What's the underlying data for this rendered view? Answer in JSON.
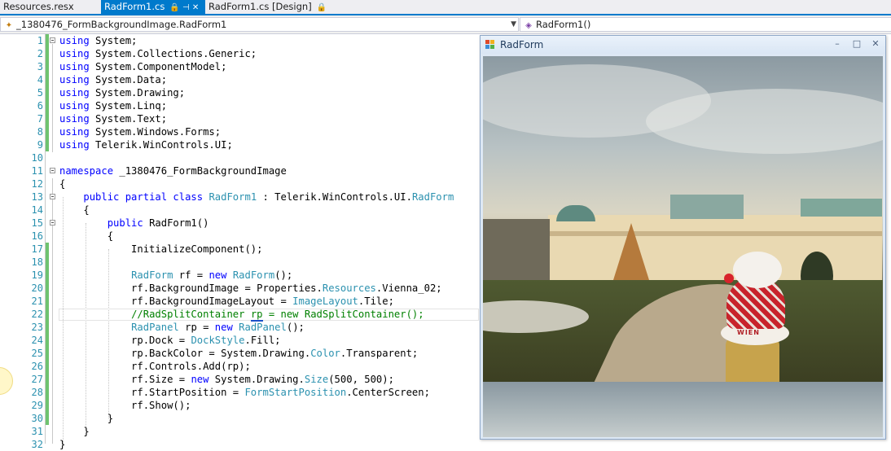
{
  "tabs": [
    {
      "label": "Resources.resx",
      "active": false,
      "icons": ""
    },
    {
      "label": "RadForm1.cs",
      "active": true,
      "icons": "🔒 ⊣ ✕"
    },
    {
      "label": "RadForm1.cs [Design]",
      "active": false,
      "icons": "🔒"
    }
  ],
  "nav": {
    "class_combo": "_1380476_FormBackgroundImage.RadForm1",
    "member_combo": "RadForm1()"
  },
  "code_lines": [
    {
      "n": "1",
      "html": "<span class=\"kw\">using</span> System;"
    },
    {
      "n": "2",
      "html": "<span class=\"kw\">using</span> System.Collections.Generic;"
    },
    {
      "n": "3",
      "html": "<span class=\"kw\">using</span> System.ComponentModel;"
    },
    {
      "n": "4",
      "html": "<span class=\"kw\">using</span> System.Data;"
    },
    {
      "n": "5",
      "html": "<span class=\"kw\">using</span> System.Drawing;"
    },
    {
      "n": "6",
      "html": "<span class=\"kw\">using</span> System.Linq;"
    },
    {
      "n": "7",
      "html": "<span class=\"kw\">using</span> System.Text;"
    },
    {
      "n": "8",
      "html": "<span class=\"kw\">using</span> System.Windows.Forms;"
    },
    {
      "n": "9",
      "html": "<span class=\"kw\">using</span> Telerik.WinControls.UI;"
    },
    {
      "n": "10",
      "html": ""
    },
    {
      "n": "11",
      "html": "<span class=\"kw\">namespace</span> _1380476_FormBackgroundImage"
    },
    {
      "n": "12",
      "html": "{"
    },
    {
      "n": "13",
      "html": "    <span class=\"kw\">public partial class</span> <span class=\"ty\">RadForm1</span> : Telerik.WinControls.UI.<span class=\"ty\">RadForm</span>"
    },
    {
      "n": "14",
      "html": "    {"
    },
    {
      "n": "15",
      "html": "        <span class=\"kw\">public</span> RadForm1()"
    },
    {
      "n": "16",
      "html": "        {"
    },
    {
      "n": "17",
      "html": "            InitializeComponent();"
    },
    {
      "n": "18",
      "html": ""
    },
    {
      "n": "19",
      "html": "            <span class=\"ty\">RadForm</span> rf = <span class=\"kw\">new</span> <span class=\"ty\">RadForm</span>();"
    },
    {
      "n": "20",
      "html": "            rf.BackgroundImage = Properties.<span class=\"ty\">Resources</span>.Vienna_02;"
    },
    {
      "n": "21",
      "html": "            rf.BackgroundImageLayout = <span class=\"ty\">ImageLayout</span>.Tile;"
    },
    {
      "n": "22",
      "html": "            <span class=\"cm\">//RadSplitContainer <span class=\"squig\">rp</span> = new RadSplitContainer();</span>"
    },
    {
      "n": "23",
      "html": "            <span class=\"ty\">RadPanel</span> rp = <span class=\"kw\">new</span> <span class=\"ty\">RadPanel</span>();"
    },
    {
      "n": "24",
      "html": "            rp.Dock = <span class=\"ty\">DockStyle</span>.Fill;"
    },
    {
      "n": "25",
      "html": "            rp.BackColor = System.Drawing.<span class=\"ty\">Color</span>.Transparent;"
    },
    {
      "n": "26",
      "html": "            rf.Controls.Add(rp);"
    },
    {
      "n": "27",
      "html": "            rf.Size = <span class=\"kw\">new</span> System.Drawing.<span class=\"ty\">Size</span>(500, 500);"
    },
    {
      "n": "28",
      "html": "            rf.StartPosition = <span class=\"ty\">FormStartPosition</span>.CenterScreen;"
    },
    {
      "n": "29",
      "html": "            rf.Show();"
    },
    {
      "n": "30",
      "html": "        }"
    },
    {
      "n": "31",
      "html": "    }"
    },
    {
      "n": "32",
      "html": "}"
    }
  ],
  "changed_lines": [
    1,
    2,
    3,
    4,
    5,
    6,
    7,
    8,
    9,
    17,
    18,
    19,
    20,
    21,
    22,
    23,
    24,
    25,
    26,
    27,
    28,
    29,
    30
  ],
  "fold_lines": [
    1,
    11,
    13,
    15
  ],
  "window": {
    "title": "RadForm",
    "minimize": "–",
    "maximize": "□",
    "close": "✕"
  },
  "photo": {
    "sign_text": "WIEN"
  },
  "colors": {
    "accent": "#007acc",
    "keyword": "#0000ff",
    "type": "#2b91af",
    "comment": "#008000",
    "change_marker": "#6fc36f"
  }
}
